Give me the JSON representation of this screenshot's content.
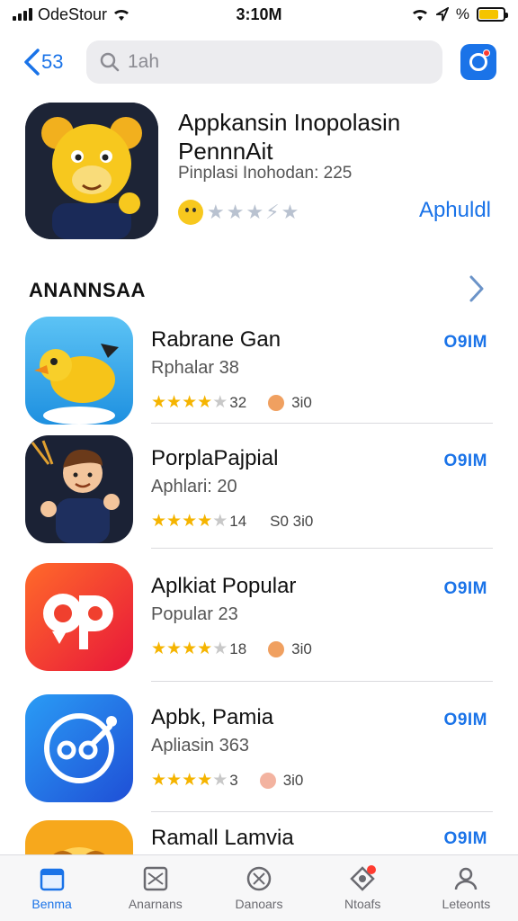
{
  "status_bar": {
    "carrier": "OdeStour",
    "time": "3:10M",
    "battery_label": "%",
    "battery_level": 0.8
  },
  "nav": {
    "back_label": "53",
    "search_placeholder": "1ah"
  },
  "featured": {
    "title": "Appkansin Inopolasin PennnAit",
    "subtitle": "Pinplasi Inohodan: 225",
    "rating_text": "★★★⚡★",
    "get_label": "Aphuldl"
  },
  "section": {
    "title": "ANANNSAA"
  },
  "apps": [
    {
      "name": "Rabrane Gan",
      "category": "Rphalar 38",
      "rating": 4.5,
      "rating_count": "32",
      "extra": "3i0",
      "get_label": "O9IM",
      "icon": "yellow-bird-icon"
    },
    {
      "name": "PorplaPajpial",
      "category": "Aphlari: 20",
      "rating": 4.5,
      "rating_count": "14",
      "extra": "S0 3i0",
      "get_label": "O9IM",
      "icon": "boy-character-icon"
    },
    {
      "name": "Aplkiat Popular",
      "category": "Popular 23",
      "rating": 4.5,
      "rating_count": "18",
      "extra": "3i0",
      "get_label": "O9IM",
      "icon": "red-logo-icon"
    },
    {
      "name": "Apbk, Pamia",
      "category": "Apliasin 363",
      "rating": 4.5,
      "rating_count": "3",
      "extra": "3i0",
      "get_label": "O9IM",
      "icon": "blue-circle-icon"
    },
    {
      "name": "Ramall Lamvia",
      "category": "",
      "rating": null,
      "rating_count": "",
      "extra": "",
      "get_label": "O9IM",
      "icon": "yellow-face-icon"
    }
  ],
  "tabs": [
    {
      "label": "Benma",
      "icon": "today-icon",
      "active": true
    },
    {
      "label": "Anarnans",
      "icon": "games-icon",
      "active": false
    },
    {
      "label": "Danoars",
      "icon": "apps-icon",
      "active": false
    },
    {
      "label": "Ntoafs",
      "icon": "arcade-icon",
      "active": false,
      "badge": true
    },
    {
      "label": "Leteonts",
      "icon": "account-icon",
      "active": false
    }
  ],
  "colors": {
    "accent": "#1a73e8",
    "star": "#f5b400"
  }
}
